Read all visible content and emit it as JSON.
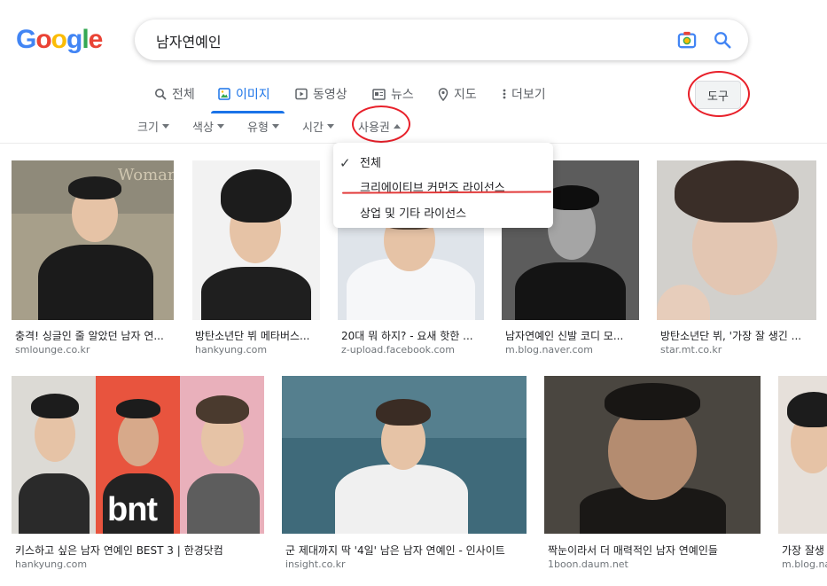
{
  "logo": "Google",
  "search": {
    "value": "남자연예인"
  },
  "tabs": [
    {
      "label": "전체"
    },
    {
      "label": "이미지"
    },
    {
      "label": "동영상"
    },
    {
      "label": "뉴스"
    },
    {
      "label": "지도"
    },
    {
      "label": "더보기"
    }
  ],
  "tools_label": "도구",
  "filters": [
    "크기",
    "색상",
    "유형",
    "시간",
    "사용권"
  ],
  "license_menu": {
    "items": [
      "전체",
      "크리에이티브 커먼즈 라이선스",
      "상업 및 기타 라이선스"
    ]
  },
  "results": [
    {
      "caption": "충격! 싱글인 줄 알았던 남자 연...",
      "source": "smlounge.co.kr"
    },
    {
      "caption": "방탄소년단 뷔 메타버스...",
      "source": "hankyung.com"
    },
    {
      "caption": "20대 뭐 하지? - 요새 핫한 ...",
      "source": "z-upload.facebook.com"
    },
    {
      "caption": "남자연예인 신발 코디 모...",
      "source": "m.blog.naver.com"
    },
    {
      "caption": "방탄소년단 뷔, '가장 잘 생긴 ...",
      "source": "star.mt.co.kr"
    },
    {
      "caption": "키스하고 싶은 남자 연예인 BEST 3 | 한경닷컴",
      "source": "hankyung.com"
    },
    {
      "caption": "군 제대까지 딱 '4일' 남은 남자 연예인 - 인사이트",
      "source": "insight.co.kr"
    },
    {
      "caption": "짝눈이라서 더 매력적인 남자 연예인들",
      "source": "1boon.daum.net"
    },
    {
      "caption": "가장 잘생",
      "source": "m.blog.na"
    }
  ],
  "image_overlays": {
    "woman_sense": "WomanSe",
    "bnt": "bnt"
  },
  "colors": {
    "accent": "#1a73e8",
    "annotation_red": "#e8202a"
  }
}
